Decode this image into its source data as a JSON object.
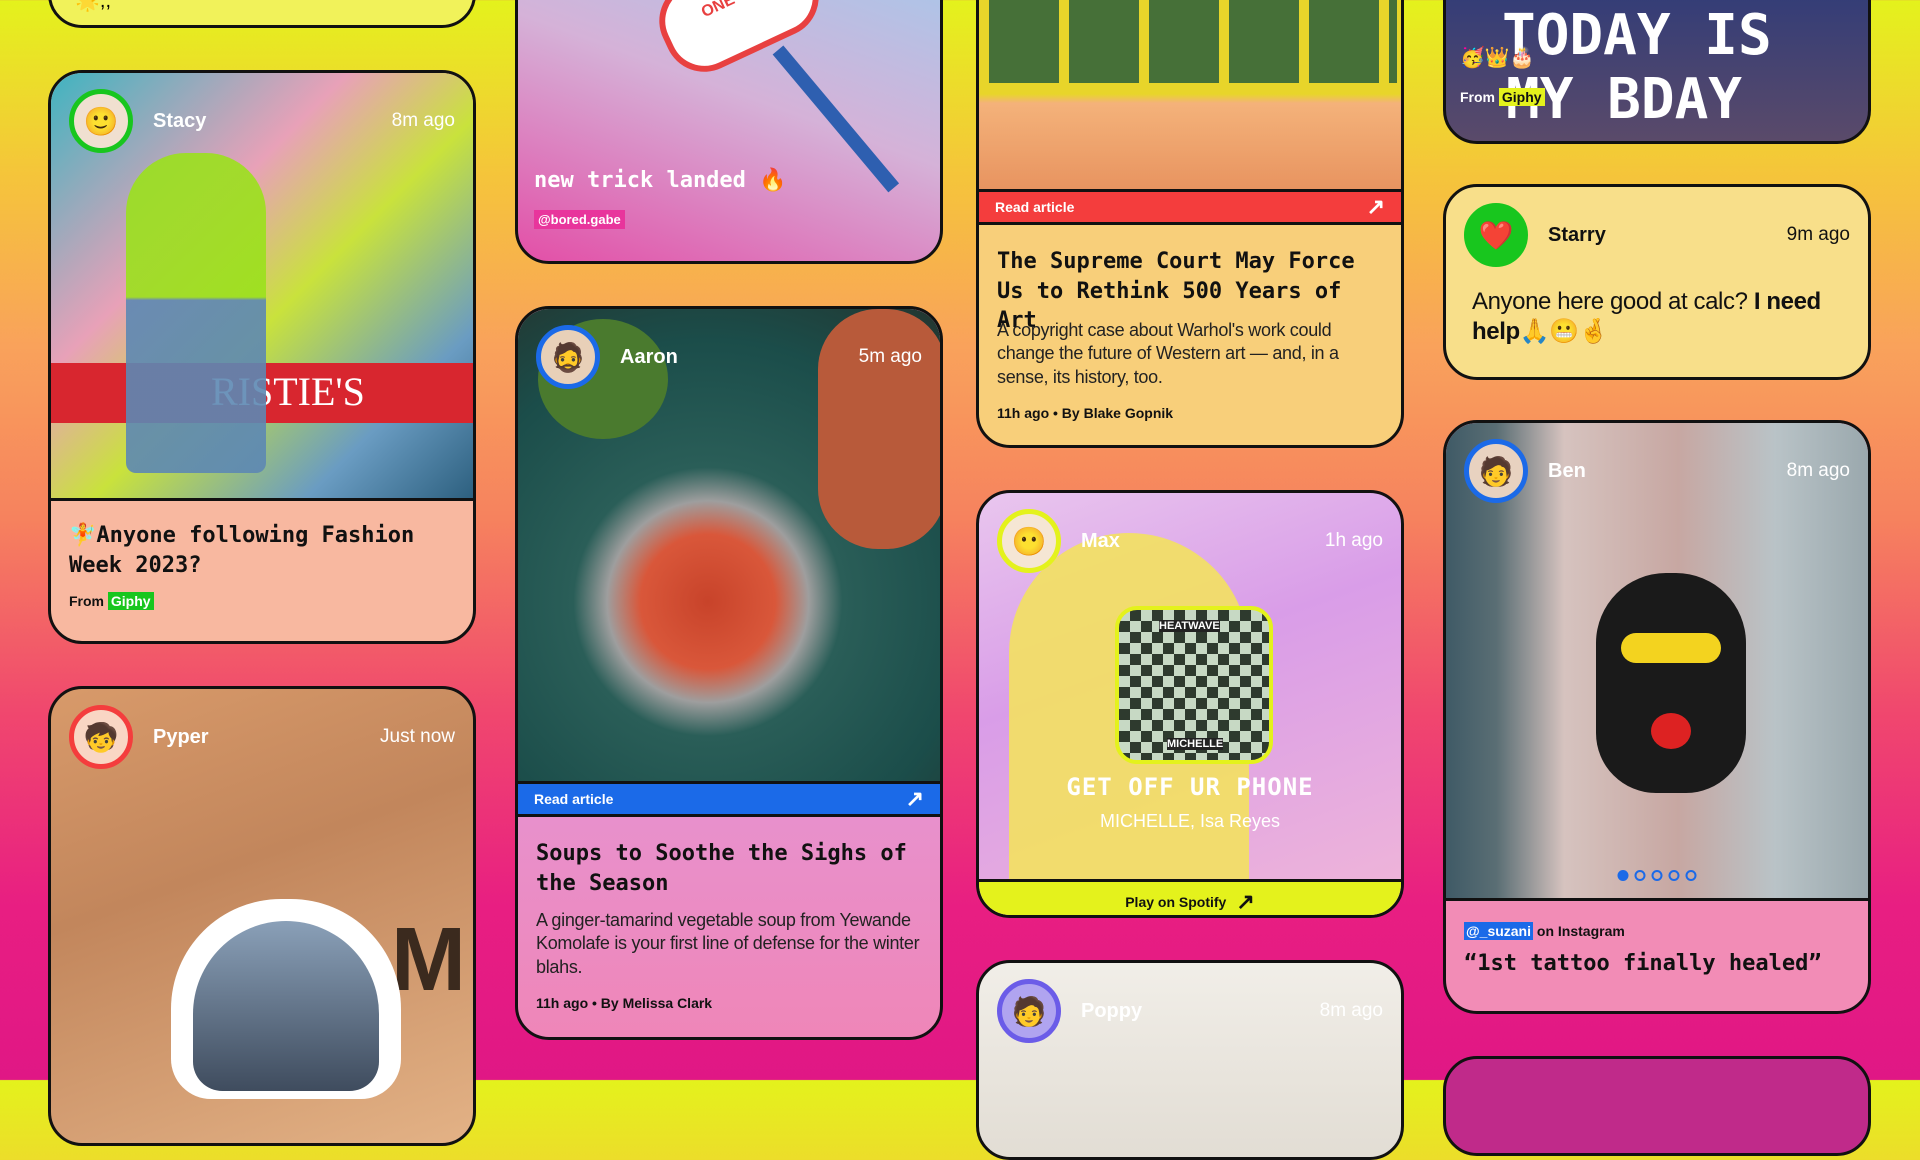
{
  "cards": {
    "top_partial": {
      "text": "🌟,,"
    },
    "stacy": {
      "name": "Stacy",
      "time": "8m ago",
      "image_caption": "RISTIE'S",
      "title": "🧚Anyone following Fashion Week 2023?",
      "from_label": "From",
      "source": "Giphy"
    },
    "pyper": {
      "name": "Pyper",
      "time": "Just now",
      "image_text": "M"
    },
    "skate": {
      "caption": "new trick landed 🔥",
      "handle": "@bored.gabe",
      "board_text": "ONE"
    },
    "aaron": {
      "name": "Aaron",
      "time": "5m ago",
      "bar_label": "Read article",
      "title": "Soups to Soothe the Sighs of the Season",
      "desc": "A ginger-tamarind vegetable soup from Yewande Komolafe is your first line of defense for the winter blahs.",
      "byline": "11h ago • By Melissa Clark"
    },
    "warhol": {
      "bar_label": "Read article",
      "title": "The Supreme Court May Force Us to Rethink 500 Years of Art",
      "desc": "A copyright case about Warhol's work could change the future of Western art — and, in a sense, its history, too.",
      "byline": "11h ago • By Blake Gopnik"
    },
    "max": {
      "name": "Max",
      "time": "1h ago",
      "album_text_top": "HEATWAVE",
      "album_text_bottom": "MICHELLE",
      "song": "GET OFF UR PHONE",
      "artist": "MICHELLE, Isa Reyes",
      "bar_label": "Play on Spotify"
    },
    "poppy": {
      "name": "Poppy",
      "time": "8m ago"
    },
    "bday": {
      "line1": "TODAY IS",
      "line2": "MY BDAY",
      "emojis": "🥳👑🎂",
      "from_label": "From",
      "source": "Giphy"
    },
    "starry": {
      "name": "Starry",
      "time": "9m ago",
      "text_plain": "Anyone here good at calc?",
      "text_bold": "I need help",
      "emojis": "🙏😬🤞"
    },
    "ben": {
      "name": "Ben",
      "time": "8m ago",
      "handle": "@_suzani",
      "platform": "on Instagram",
      "quote": "“1st tattoo finally healed”"
    }
  },
  "colors": {
    "read_bar_red": "#f43d3d",
    "read_bar_blue": "#1b6ae8",
    "spotify_bar": "#e4f21c",
    "giphy_green": "#18c61e"
  }
}
